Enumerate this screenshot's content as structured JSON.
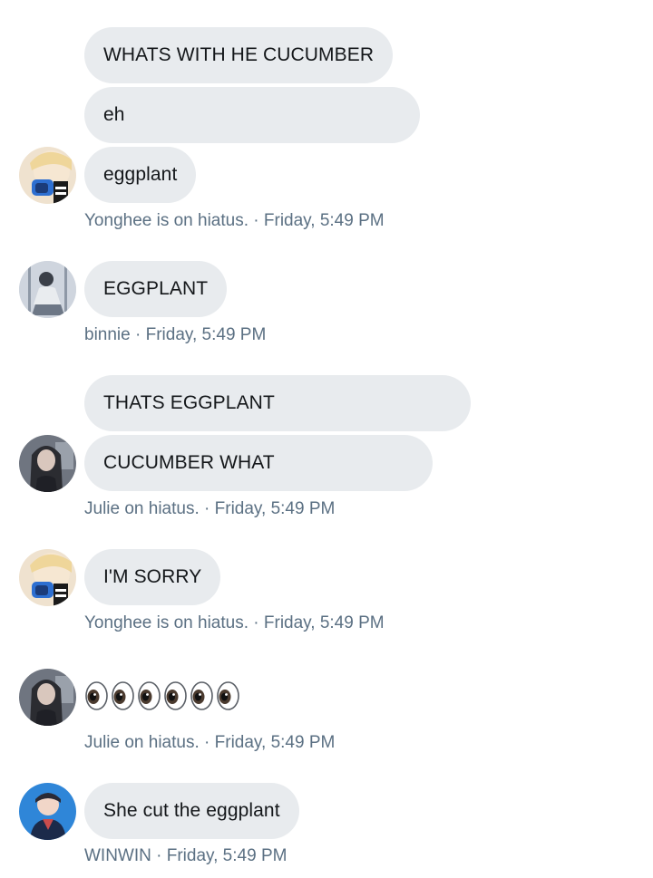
{
  "messages": [
    {
      "text": "WHATS WITH HE CUCUMBER"
    },
    {
      "text": "eh"
    },
    {
      "text": "eggplant"
    },
    {
      "text": "EGGPLANT"
    },
    {
      "text": "THATS EGGPLANT"
    },
    {
      "text": "CUCUMBER WHAT"
    },
    {
      "text": "I'M SORRY"
    },
    {
      "emoji": "eyes-emoji",
      "count": 6
    },
    {
      "text": "She cut the eggplant"
    }
  ],
  "meta": [
    {
      "text": "Yonghee is on hiatus. · Friday, 5:49 PM"
    },
    {
      "text": "binnie · Friday, 5:49 PM"
    },
    {
      "text": "Julie on hiatus. · Friday, 5:49 PM"
    },
    {
      "text": "Yonghee is on hiatus. · Friday, 5:49 PM"
    },
    {
      "text": "Julie on hiatus. · Friday, 5:49 PM"
    },
    {
      "text": "WINWIN · Friday, 5:49 PM"
    }
  ],
  "colors": {
    "bubble": "#e8ebee",
    "text": "#14171a",
    "meta": "#5b7083",
    "background": "#ffffff"
  }
}
